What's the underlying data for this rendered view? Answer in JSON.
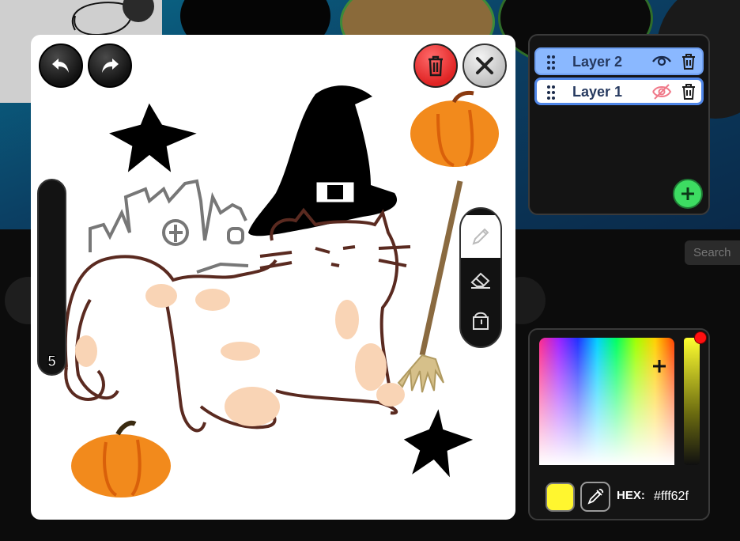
{
  "history": {
    "undo": "undo",
    "redo": "redo"
  },
  "brush": {
    "size": "5"
  },
  "tools": [
    {
      "name": "pencil",
      "active": true
    },
    {
      "name": "eraser",
      "active": false
    },
    {
      "name": "fill",
      "active": false
    }
  ],
  "layers": [
    {
      "label": "Layer 2",
      "visible": true,
      "selected": true
    },
    {
      "label": "Layer 1",
      "visible": false,
      "selected": false
    }
  ],
  "color": {
    "hex_label": "HEX:",
    "hex_value": "#fff62f",
    "current": "#fff62f"
  },
  "background": {
    "search_placeholder": "Search"
  },
  "colors": {
    "accent_green": "#3ddc62",
    "delete_red": "#e02424",
    "selected_layer": "#8ab8ff"
  }
}
